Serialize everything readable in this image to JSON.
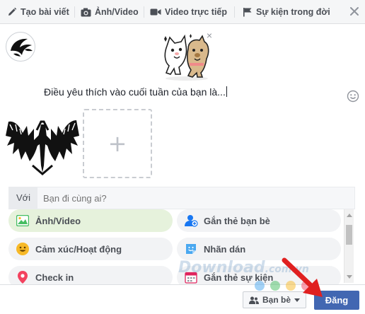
{
  "tabs": [
    {
      "label": "Tạo bài viết",
      "icon": "pencil-icon"
    },
    {
      "label": "Ảnh/Video",
      "icon": "camera-icon"
    },
    {
      "label": "Video trực tiếp",
      "icon": "video-camera-icon"
    },
    {
      "label": "Sự kiện trong đời",
      "icon": "flag-icon"
    }
  ],
  "composer": {
    "text": "Điều yêu thích vào cuối tuần của bạn là...",
    "sticker_close": "×"
  },
  "with_row": {
    "label": "Với",
    "placeholder": "Bạn đi cùng ai?"
  },
  "options": [
    {
      "label": "Ảnh/Video",
      "icon": "photo-icon",
      "selected": true
    },
    {
      "label": "Gắn thẻ bạn bè",
      "icon": "tag-friends-icon",
      "selected": false
    },
    {
      "label": "Cảm xúc/Hoạt động",
      "icon": "smiley-icon",
      "selected": false
    },
    {
      "label": "Nhãn dán",
      "icon": "sticker-icon",
      "selected": false
    },
    {
      "label": "Check in",
      "icon": "location-pin-icon",
      "selected": false
    },
    {
      "label": "Gắn thẻ sự kiện",
      "icon": "calendar-icon",
      "selected": false
    }
  ],
  "footer": {
    "audience": "Bạn bè",
    "post_button": "Đăng"
  },
  "watermark": {
    "text": "Download",
    "domain": ".com.vn"
  },
  "colors": {
    "primary": "#4267b2",
    "selected_option": "#e6f2dc",
    "arrow": "#e02020"
  }
}
